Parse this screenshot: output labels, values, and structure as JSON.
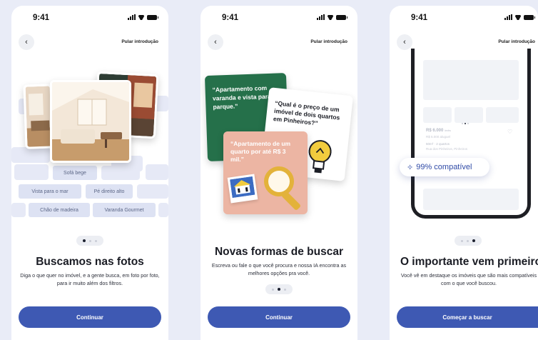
{
  "status": {
    "time": "9:41"
  },
  "common": {
    "skip_label": "Pular introdução",
    "back_icon": "chevron-left-icon"
  },
  "screen1": {
    "chips": [
      "Sofá bege",
      "Vista para o mar",
      "Pé direito alto",
      "Chão de madeira",
      "Varanda Gourmet"
    ],
    "title": "Buscamos nas fotos",
    "description": "Diga o que quer no imóvel, e a gente busca, em foto por foto, para ir muito além dos filtros.",
    "cta": "Continuar",
    "active_dot": 1
  },
  "screen2": {
    "card_green": "“Apartamento com varanda e vista para o parque.”",
    "card_white": "“Qual é o preço de um imóvel de dois quartos em Pinheiros?”",
    "card_pink": "“Apartamento de um quarto por até R$ 3 mil.”",
    "title": "Novas formas de buscar",
    "description": "Escreva ou fale o que você procura e nossa IA encontra as melhores opções pra você.",
    "cta": "Continuar",
    "active_dot": 2
  },
  "screen3": {
    "listing_price": "R$ 6.000",
    "listing_price_suffix": "/mês",
    "listing_sub": "R$ 5.000 aluguel",
    "listing_area": "50m² · 2 quartos",
    "listing_address": "Rua dos Pinheiros, Pinheiros",
    "badge": "99% compatível",
    "badge_icon": "sparkle-icon",
    "title": "O importante vem primeiro",
    "description": "Você vê em destaque os imóveis que são mais compatíveis com o que você buscou.",
    "cta": "Começar a buscar",
    "active_dot": 3
  },
  "colors": {
    "accent": "#3e59b3",
    "background": "#e9ecf7"
  }
}
